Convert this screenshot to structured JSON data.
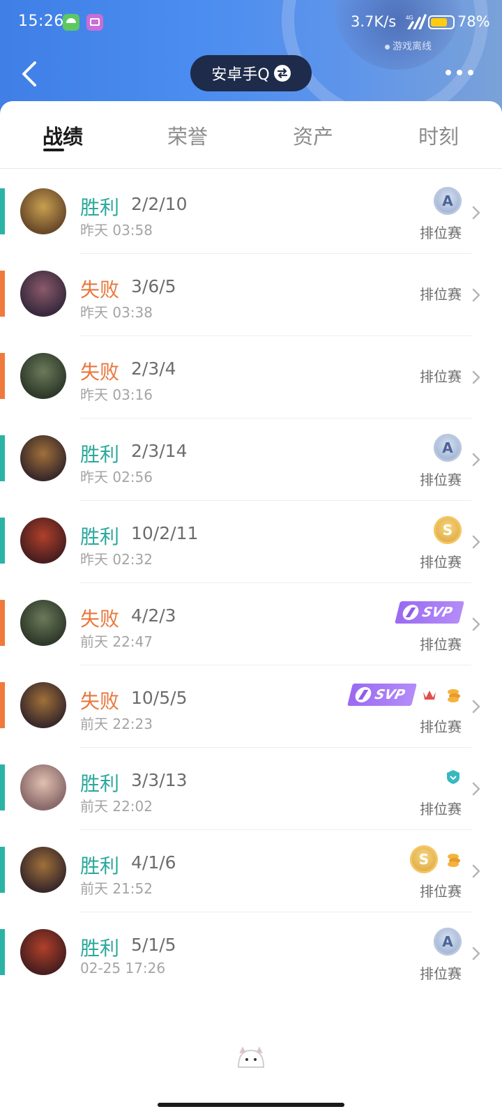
{
  "status_bar": {
    "time": "15:26",
    "net_speed": "3.7K/s",
    "network_type": "4G",
    "battery_percent": "78%",
    "battery_level": 0.78,
    "notification_icons": [
      "umbrella-app-icon",
      "media-app-icon"
    ]
  },
  "header": {
    "offline_status": "游戏离线",
    "account_label": "安卓手Q",
    "back_icon": "chevron-left-icon",
    "more_icon": "more-dots-icon",
    "swap_icon": "swap-arrows-icon"
  },
  "tabs": [
    {
      "label": "战绩",
      "active": true
    },
    {
      "label": "荣誉",
      "active": false
    },
    {
      "label": "资产",
      "active": false
    },
    {
      "label": "时刻",
      "active": false
    }
  ],
  "colors": {
    "win": "#2aa89c",
    "lose": "#e8763a",
    "header_gradient_start": "#3f7fe6",
    "account_pill": "#1e2b4a",
    "svp_purple": "#9a6af2"
  },
  "matches": [
    {
      "result": "胜利",
      "outcome": "win",
      "kda": "2/2/10",
      "time": "昨天 03:58",
      "mode": "排位赛",
      "badges": [
        "A"
      ]
    },
    {
      "result": "失败",
      "outcome": "lose",
      "kda": "3/6/5",
      "time": "昨天 03:38",
      "mode": "排位赛",
      "badges": []
    },
    {
      "result": "失败",
      "outcome": "lose",
      "kda": "2/3/4",
      "time": "昨天 03:16",
      "mode": "排位赛",
      "badges": []
    },
    {
      "result": "胜利",
      "outcome": "win",
      "kda": "2/3/14",
      "time": "昨天 02:56",
      "mode": "排位赛",
      "badges": [
        "A"
      ]
    },
    {
      "result": "胜利",
      "outcome": "win",
      "kda": "10/2/11",
      "time": "昨天 02:32",
      "mode": "排位赛",
      "badges": [
        "S"
      ]
    },
    {
      "result": "失败",
      "outcome": "lose",
      "kda": "4/2/3",
      "time": "前天 22:47",
      "mode": "排位赛",
      "badges": [
        "SVP"
      ]
    },
    {
      "result": "失败",
      "outcome": "lose",
      "kda": "10/5/5",
      "time": "前天 22:23",
      "mode": "排位赛",
      "badges": [
        "SVP",
        "crown",
        "coins"
      ]
    },
    {
      "result": "胜利",
      "outcome": "win",
      "kda": "3/3/13",
      "time": "前天 22:02",
      "mode": "排位赛",
      "badges": [
        "shield"
      ]
    },
    {
      "result": "胜利",
      "outcome": "win",
      "kda": "4/1/6",
      "time": "前天 21:52",
      "mode": "排位赛",
      "badges": [
        "S",
        "coins"
      ]
    },
    {
      "result": "胜利",
      "outcome": "win",
      "kda": "5/1/5",
      "time": "02-25 17:26",
      "mode": "排位赛",
      "badges": [
        "A"
      ]
    }
  ],
  "badge_text": {
    "A": "A",
    "S": "S",
    "SVP": "SVP"
  }
}
